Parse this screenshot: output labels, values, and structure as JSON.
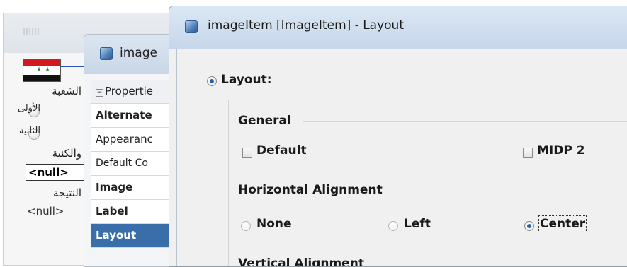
{
  "background_form": {
    "arabic_labels": [
      "الشعبة",
      "الأولى",
      "الثانية",
      "والكنية",
      "النتيجة"
    ],
    "null_field_value": "<null>",
    "null_plain_value": "<null>"
  },
  "properties_window": {
    "title": "image",
    "rows": [
      {
        "label": "Propertie",
        "style": "header"
      },
      {
        "label": "Alternate",
        "style": "bold"
      },
      {
        "label": "Appearanc",
        "style": "normal"
      },
      {
        "label": "Default Co",
        "style": "normal"
      },
      {
        "label": "Image",
        "style": "bold"
      },
      {
        "label": "Label",
        "style": "bold"
      },
      {
        "label": "Layout",
        "style": "selected"
      }
    ]
  },
  "layout_dialog": {
    "title": "imageItem [ImageItem] - Layout",
    "layout_option": {
      "label": "Layout:",
      "selected": true
    },
    "general": {
      "heading": "General",
      "default_label": "Default",
      "default_checked": false,
      "midp2_label": "MIDP 2",
      "midp2_checked": false
    },
    "horizontal_alignment": {
      "heading": "Horizontal Alignment",
      "options": [
        {
          "label": "None",
          "selected": false,
          "enabled": false
        },
        {
          "label": "Left",
          "selected": false,
          "enabled": false
        },
        {
          "label": "Center",
          "selected": true,
          "enabled": true
        }
      ]
    },
    "vertical_alignment": {
      "heading": "Vertical Alignment"
    }
  },
  "colors": {
    "selection": "#3a6ea8",
    "titlebar": "#c6d7ea",
    "flag_red": "#d31820",
    "flag_black": "#111111"
  }
}
